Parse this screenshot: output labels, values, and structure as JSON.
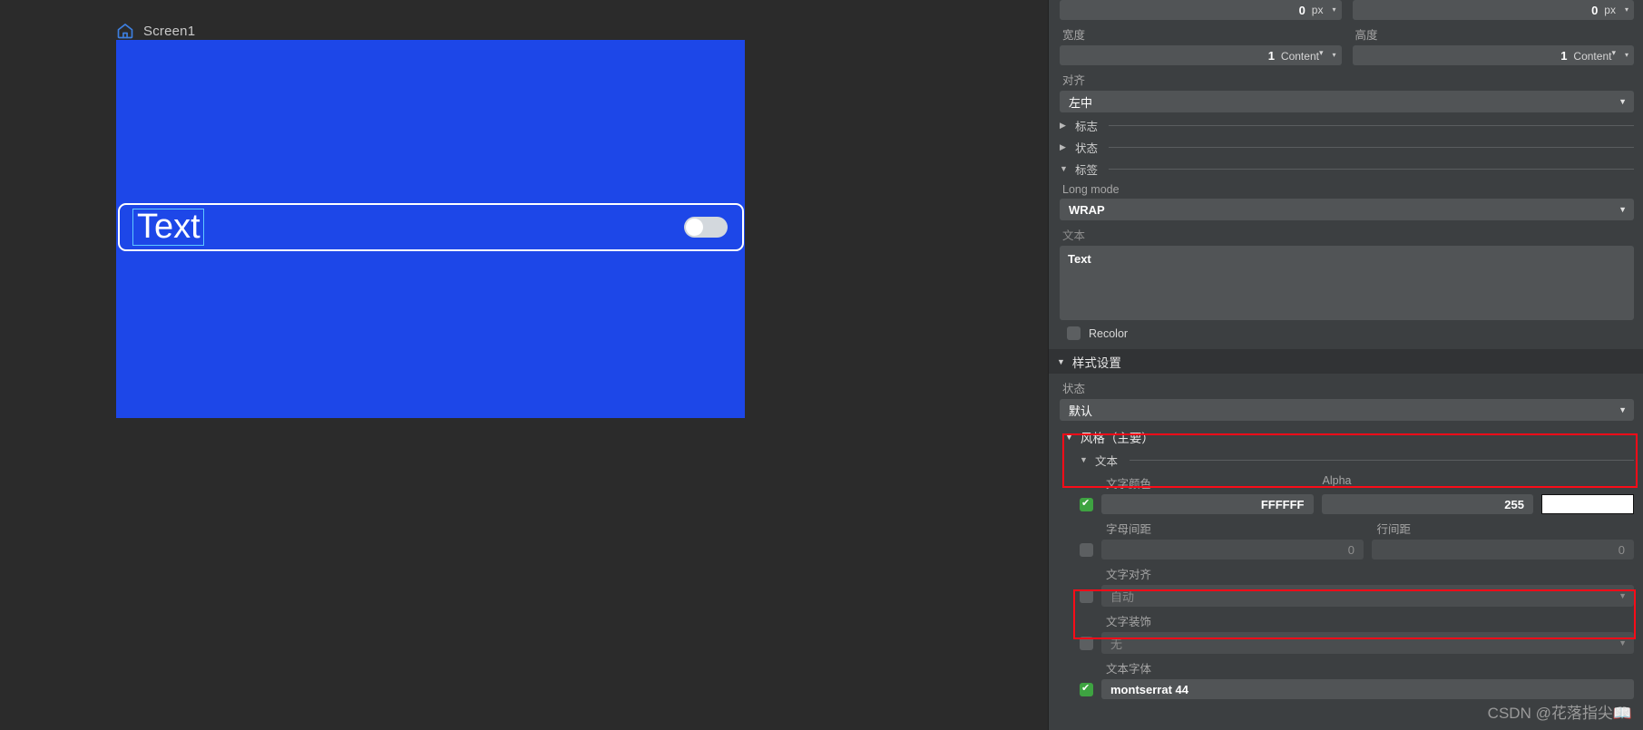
{
  "canvas": {
    "screen_name": "Screen1",
    "home_icon": "home-icon",
    "widget_text": "Text",
    "toggle_state": "off",
    "screen_bg": "#1d47e8",
    "selection_color": "#5fc8ff"
  },
  "panel": {
    "pos_x": {
      "value": "0",
      "unit": "px"
    },
    "pos_y": {
      "value": "0",
      "unit": "px"
    },
    "width": {
      "label": "宽度",
      "value": "1",
      "unit": "Content"
    },
    "height": {
      "label": "高度",
      "value": "1",
      "unit": "Content"
    },
    "align": {
      "label": "对齐",
      "value": "左中"
    },
    "collapsibles": [
      {
        "label": "标志",
        "expanded": false
      },
      {
        "label": "状态",
        "expanded": false
      },
      {
        "label": "标签",
        "expanded": true
      }
    ],
    "long_mode": {
      "label": "Long mode",
      "value": "WRAP"
    },
    "text_field": {
      "label": "文本",
      "value": "Text"
    },
    "recolor": {
      "label": "Recolor",
      "checked": false
    },
    "style_settings": {
      "title": "样式设置",
      "state": {
        "label": "状态",
        "value": "默认"
      },
      "style_group": "风格（主要）",
      "text_group": "文本",
      "text_color": {
        "label": "文字颜色",
        "value": "FFFFFF",
        "checked": true,
        "swatch": "#FFFFFF"
      },
      "alpha": {
        "label": "Alpha",
        "value": "255"
      },
      "letter_spacing": {
        "label": "字母间距",
        "value": "0",
        "checked": false
      },
      "line_spacing": {
        "label": "行间距",
        "value": "0",
        "checked": false
      },
      "text_align": {
        "label": "文字对齐",
        "value": "自动",
        "checked": false
      },
      "text_decoration": {
        "label": "文字装饰",
        "value": "无",
        "checked": false
      },
      "text_font": {
        "label": "文本字体",
        "value": "montserrat 44",
        "checked": true
      }
    }
  },
  "annotations": {
    "highlight_color": "#fb0c18",
    "watermark": "CSDN @花落指尖📖"
  }
}
